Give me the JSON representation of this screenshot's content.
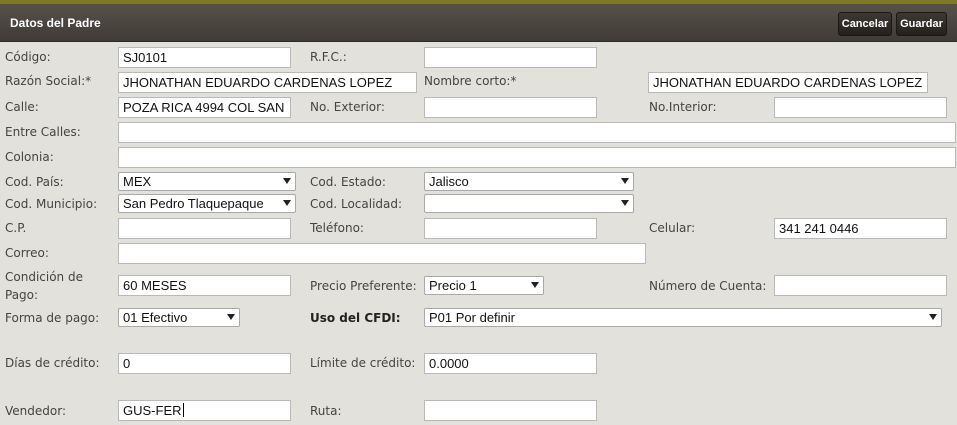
{
  "header": {
    "title": "Datos del Padre",
    "cancel_label": "Cancelar",
    "save_label": "Guardar"
  },
  "labels": {
    "codigo": "Código:",
    "rfc": "R.F.C.:",
    "razon_social": "Razón Social:*",
    "nombre_corto": "Nombre corto:*",
    "calle": "Calle:",
    "no_exterior": "No. Exterior:",
    "no_interior": "No.Interior:",
    "entre_calles": "Entre Calles:",
    "colonia": "Colonia:",
    "cod_pais": "Cod. País:",
    "cod_estado": "Cod. Estado:",
    "cod_municipio": "Cod. Municipio:",
    "cod_localidad": "Cod. Localidad:",
    "cp": "C.P.",
    "telefono": "Teléfono:",
    "celular": "Celular:",
    "correo": "Correo:",
    "condicion_pago_1": "Condición de",
    "condicion_pago_2": "Pago:",
    "precio_preferente": "Precio Preferente:",
    "numero_cuenta": "Número de Cuenta:",
    "forma_pago": "Forma de pago:",
    "uso_cfdi": "Uso del CFDI:",
    "dias_credito": "Días de crédito:",
    "limite_credito": "Límite de crédito:",
    "vendedor": "Vendedor:",
    "ruta": "Ruta:"
  },
  "values": {
    "codigo": "SJ0101",
    "rfc": "",
    "razon_social": "JHONATHAN EDUARDO CARDENAS LOPEZ",
    "nombre_corto": "JHONATHAN EDUARDO CARDENAS LOPEZ",
    "calle": "POZA RICA 4994 COL SAN",
    "no_exterior": "",
    "no_interior": "",
    "entre_calles": "",
    "colonia": "",
    "cod_pais": "MEX",
    "cod_estado": "Jalisco",
    "cod_municipio": "San Pedro Tlaquepaque",
    "cod_localidad": "",
    "cp": "",
    "telefono": "",
    "celular": "341 241 0446",
    "correo": "",
    "condicion_pago": "60 MESES",
    "precio_preferente": "Precio 1",
    "numero_cuenta": "",
    "forma_pago": "01 Efectivo",
    "uso_cfdi": "P01 Por definir",
    "dias_credito": "0",
    "limite_credito": "0.0000",
    "vendedor": "GUS-FER",
    "ruta": ""
  }
}
